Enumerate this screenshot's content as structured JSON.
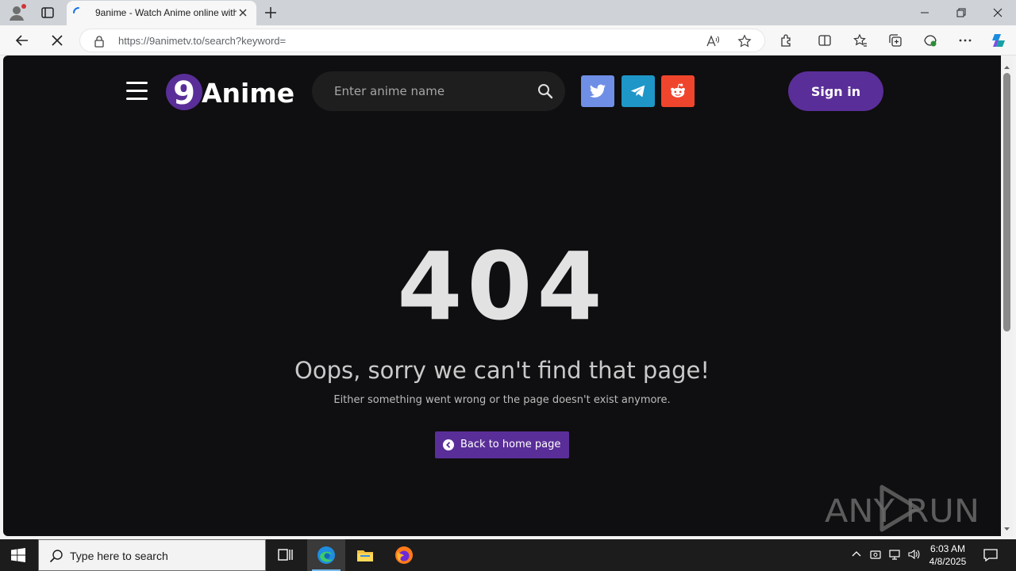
{
  "browser": {
    "tab": {
      "title": "9anime - Watch Anime online with"
    },
    "address": {
      "url_host": "https://9animetv.to",
      "url_path": "/search?keyword="
    }
  },
  "site": {
    "logo_text": "Anime",
    "logo_number": "9",
    "search": {
      "placeholder": "Enter anime name"
    },
    "socials": [
      {
        "name": "twitter",
        "color": "#6f8ee5"
      },
      {
        "name": "telegram",
        "color": "#1e96c8"
      },
      {
        "name": "reddit",
        "color": "#f0452d"
      }
    ],
    "signin_label": "Sign in",
    "accent_color": "#5a2e98"
  },
  "error": {
    "code": "404",
    "title": "Oops, sorry we can't find that page!",
    "subtitle": "Either something went wrong or the page doesn't exist anymore.",
    "home_button": "Back to home page"
  },
  "watermark": {
    "text": "ANY RUN"
  },
  "taskbar": {
    "search_placeholder": "Type here to search",
    "time": "6:03 AM",
    "date": "4/8/2025"
  }
}
